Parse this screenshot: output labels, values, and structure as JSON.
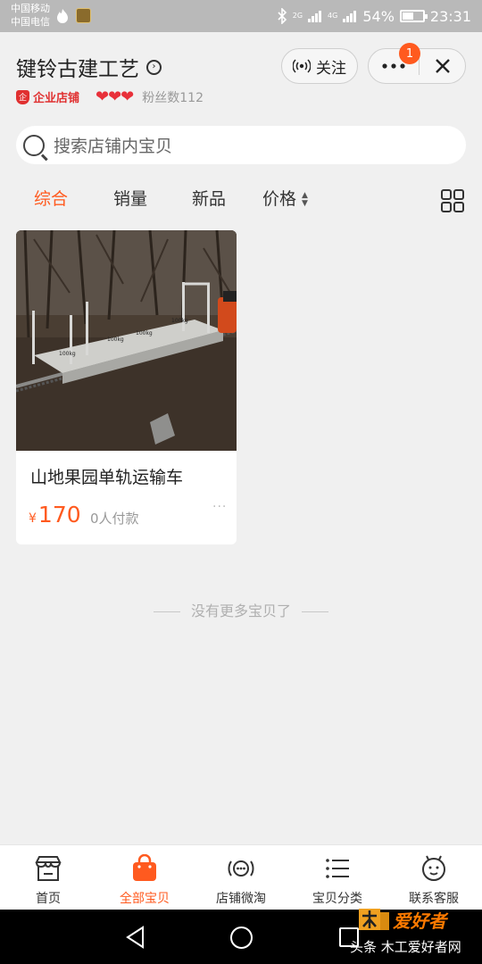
{
  "status_bar": {
    "carrier_1": "中国移动",
    "carrier_2": "中国电信",
    "net_1": "2G",
    "net_2": "4G",
    "battery": "54%",
    "battery_level": 0.54,
    "time": "23:31"
  },
  "header": {
    "shop_name": "键铃古建工艺",
    "shop_type": "企业店铺",
    "hearts": "❤❤❤",
    "fans": "粉丝数112",
    "follow_label": "关注",
    "more_icon": "more-dots-icon",
    "close_icon": "close-icon",
    "notification_count": "1"
  },
  "search": {
    "placeholder": "搜索店铺内宝贝"
  },
  "sort_tabs": [
    {
      "label": "综合",
      "active": true
    },
    {
      "label": "销量",
      "active": false
    },
    {
      "label": "新品",
      "active": false
    },
    {
      "label": "价格",
      "active": false
    }
  ],
  "products": [
    {
      "title": "山地果园单轨运输车",
      "currency": "¥",
      "price": "170",
      "paid": "0人付款",
      "more": "···",
      "image_labels": [
        "100kg",
        "100kg",
        "100kg",
        "100kg"
      ]
    }
  ],
  "list_end": "没有更多宝贝了",
  "bottom_tabs": [
    {
      "label": "首页",
      "icon": "store-icon",
      "active": false
    },
    {
      "label": "全部宝贝",
      "icon": "shopping-bag-icon",
      "active": true
    },
    {
      "label": "店铺微淘",
      "icon": "broadcast-icon",
      "active": false
    },
    {
      "label": "宝贝分类",
      "icon": "category-list-icon",
      "active": false
    },
    {
      "label": "联系客服",
      "icon": "customer-service-icon",
      "active": false
    }
  ],
  "watermark": {
    "logo_text": "爱好者",
    "caption": "头条 木工爱好者网"
  },
  "colors": {
    "accent": "#ff5a1f",
    "heart": "#e8303a",
    "status_bar": "#b9b9b9"
  }
}
